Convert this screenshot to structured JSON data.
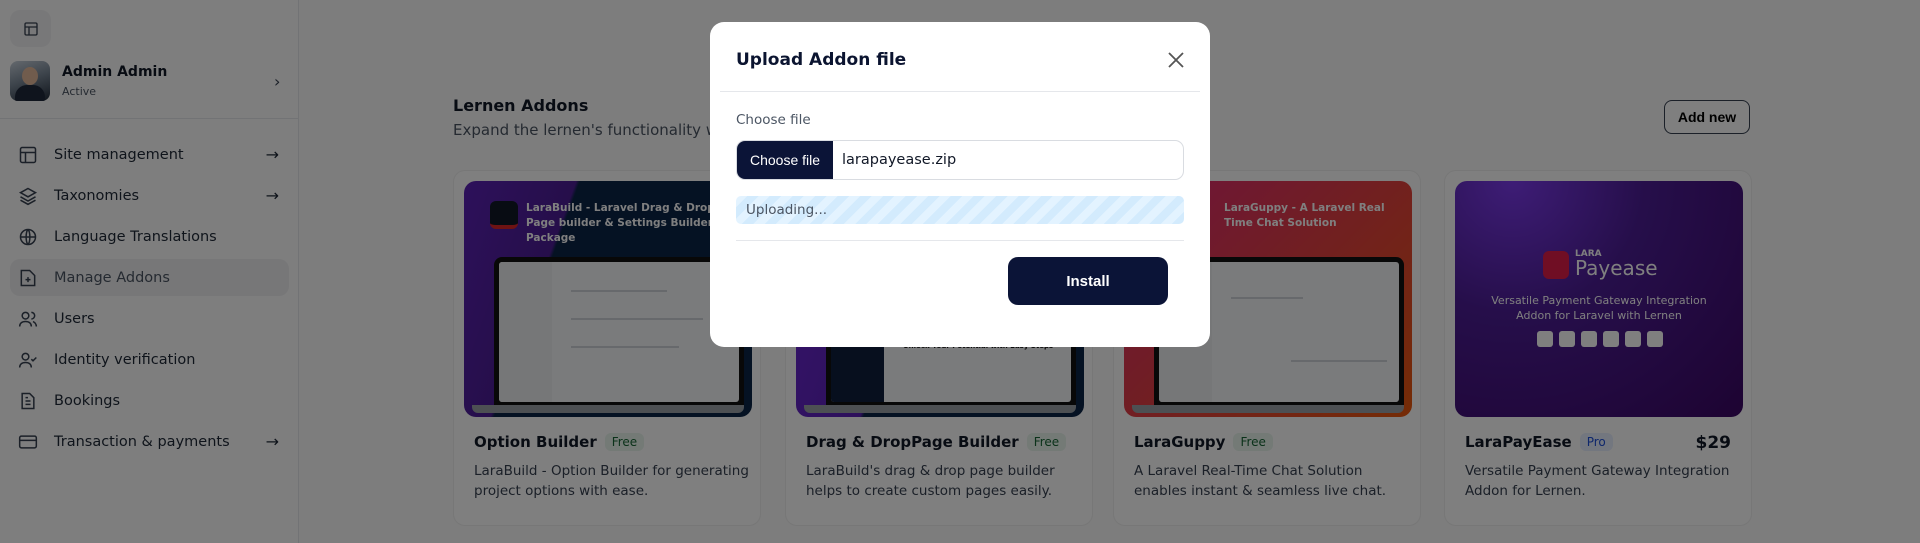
{
  "sidebar": {
    "user": {
      "name": "Admin Admin",
      "status": "Active"
    },
    "items": [
      {
        "label": "Site management",
        "icon": "layout-icon",
        "arrow": true
      },
      {
        "label": "Taxonomies",
        "icon": "layers-icon",
        "arrow": true
      },
      {
        "label": "Language Translations",
        "icon": "globe-icon",
        "arrow": false
      },
      {
        "label": "Manage Addons",
        "icon": "folder-plus-icon",
        "arrow": false,
        "active": true
      },
      {
        "label": "Users",
        "icon": "users-icon",
        "arrow": false
      },
      {
        "label": "Identity verification",
        "icon": "user-check-icon",
        "arrow": false
      },
      {
        "label": "Bookings",
        "icon": "file-text-icon",
        "arrow": false
      },
      {
        "label": "Transaction & payments",
        "icon": "credit-card-icon",
        "arrow": true
      }
    ]
  },
  "main": {
    "title": "Lernen Addons",
    "subtitle": "Expand the lernen's functionality with addons",
    "add_new": "Add new",
    "cards": [
      {
        "name": "Option Builder",
        "badge": "Free",
        "price": "",
        "desc": "LaraBuild - Option Builder for generating project options with ease.",
        "image_text": "LaraBuild - Laravel Drag & Drop Page builder & Settings Builder Package"
      },
      {
        "name": "Drag & DropPage Builder",
        "badge": "Free",
        "price": "",
        "desc": "LaraBuild's drag & drop page builder helps to create custom pages easily.",
        "image_text": "Unlock Your Potential with Easy Steps"
      },
      {
        "name": "LaraGuppy",
        "badge": "Free",
        "price": "",
        "desc": "A Laravel Real-Time Chat Solution enables instant & seamless live chat.",
        "image_text": "LaraGuppy - A Laravel Real Time Chat Solution"
      },
      {
        "name": "LaraPayEase",
        "badge": "Pro",
        "price": "$29",
        "desc": "Versatile Payment Gateway Integration Addon for Lernen.",
        "image_text": "Versatile Payment Gateway Integration Addon for Laravel with Lernen",
        "logo_small": "LARA",
        "logo_big": "Payease"
      }
    ]
  },
  "modal": {
    "title": "Upload Addon file",
    "label": "Choose file",
    "choose_button": "Choose file",
    "file_name": "larapayease.zip",
    "progress_text": "Uploading...",
    "install": "Install"
  },
  "colors": {
    "primary": "#0b1437",
    "overlay": "rgba(0,0,0,0.5)"
  }
}
